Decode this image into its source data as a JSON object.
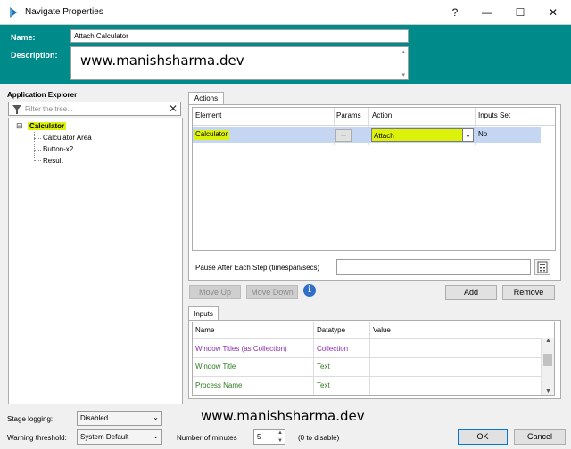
{
  "window": {
    "title": "Navigate Properties",
    "controls": [
      "?",
      "—",
      "☐",
      "✕"
    ]
  },
  "header": {
    "name_label": "Name:",
    "name_value": "Attach Calculator",
    "description_label": "Description:",
    "description_value": "www.manishsharma.dev"
  },
  "explorer": {
    "title": "Application Explorer",
    "filter_placeholder": "Filter the tree...",
    "root": {
      "label": "Calculator",
      "expander": "⊟"
    },
    "children": [
      "Calculator Area",
      "Button-x2",
      "Result"
    ]
  },
  "actions": {
    "tab_label": "Actions",
    "columns": [
      "Element",
      "Params",
      "Action",
      "Inputs Set"
    ],
    "row": {
      "element": "Calculator",
      "params": "...",
      "action": "Attach",
      "inputs_set": "No"
    },
    "pause_label": "Pause After Each Step (timespan/secs)",
    "move_up_label": "Move Up",
    "move_down_label": "Move Down",
    "add_label": "Add",
    "remove_label": "Remove"
  },
  "inputs": {
    "tab_label": "Inputs",
    "columns": [
      "Name",
      "Datatype",
      "Value"
    ],
    "rows": [
      {
        "name": "Window Titles (as Collection)",
        "datatype": "Collection",
        "color": "purple"
      },
      {
        "name": "Window Title",
        "datatype": "Text",
        "color": "green"
      },
      {
        "name": "Process Name",
        "datatype": "Text",
        "color": "green"
      }
    ]
  },
  "footer": {
    "watermark": "www.manishsharma.dev",
    "stage_logging_label": "Stage logging:",
    "stage_logging_value": "Disabled",
    "warning_threshold_label": "Warning threshold:",
    "warning_threshold_value": "System Default",
    "minutes_label": "Number of minutes",
    "minutes_value": "5",
    "disable_hint": "(0 to disable)",
    "ok_label": "OK",
    "cancel_label": "Cancel"
  },
  "colors": {
    "accent": "#008b8b",
    "highlight": "#ddf20a",
    "selected_row": "#c5d6f2",
    "purple_text": "#8b2fa8",
    "green_text": "#2d7a1f"
  }
}
